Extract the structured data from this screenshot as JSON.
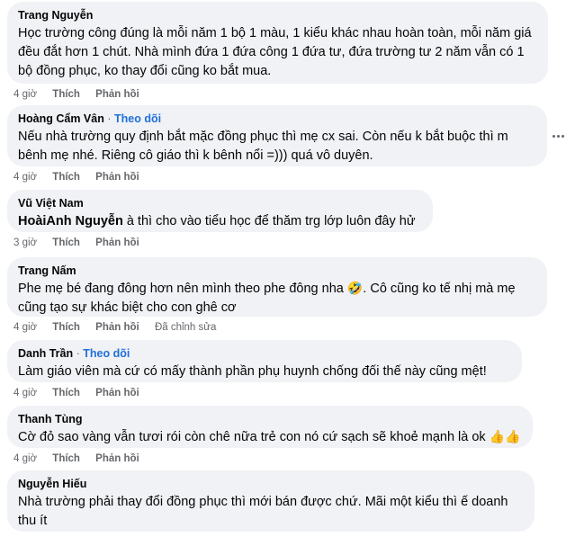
{
  "comments": [
    {
      "author": "Trang Nguyễn",
      "text": "Học trường công đúng là mỗi năm 1 bộ 1 màu, 1 kiểu khác nhau hoàn toàn, mỗi năm giá đều đắt hơn 1 chút. Nhà mình đứa 1 đứa công 1 đứa tư, đứa trường tư 2 năm vẫn có 1 bộ đồng phục, ko thay đổi cũng ko bắt mua.",
      "time": "4 giờ",
      "like": "Thích",
      "reply": "Phản hồi"
    },
    {
      "author": "Hoàng Cẩm Vân",
      "follow": "Theo dõi",
      "text": "Nếu nhà trường quy định bắt mặc đồng phục thì mẹ cx sai. Còn nếu k bắt buộc thì m bênh mẹ nhé. Riêng cô giáo thì k bênh nổi =))) quá vô duyên.",
      "time": "4 giờ",
      "like": "Thích",
      "reply": "Phản hồi"
    },
    {
      "author": "Vũ Việt Nam",
      "mention": "HoàiAnh Nguyễn",
      "text": " à thì cho vào tiểu học để thăm trg lớp luôn đây hử",
      "time": "3 giờ",
      "like": "Thích",
      "reply": "Phản hồi"
    },
    {
      "author": "Trang Nấm",
      "text": "Phe mẹ bé đang đông hơn nên mình theo phe đông nha",
      "emoji": "🤣",
      "text_after": ". Cô cũng ko tế nhị mà mẹ cũng tạo sự khác biệt cho con ghê cơ",
      "time": "4 giờ",
      "like": "Thích",
      "reply": "Phản hồi",
      "edited": "Đã chỉnh sửa"
    },
    {
      "author": "Danh Trần",
      "follow": "Theo dõi",
      "text": "Làm giáo viên mà cứ có mấy thành phần phụ huynh chống đối thế này cũng mệt!",
      "time": "4 giờ",
      "like": "Thích",
      "reply": "Phản hồi"
    },
    {
      "author": "Thanh Tùng",
      "text": "Cờ đỏ sao vàng vẫn tươi rói còn chê nữa trẻ con nó cứ sạch sẽ khoẻ mạnh là ok",
      "emoji": "👍👍",
      "time": "4 giờ",
      "like": "Thích",
      "reply": "Phản hồi"
    },
    {
      "author": "Nguyễn Hiếu",
      "text": "Nhà trường phải thay đổi đồng phục thì mới bán được chứ. Mãi một kiểu thì ế doanh thu ít"
    }
  ],
  "separator": "·",
  "more_icon": "more-horizontal-icon"
}
